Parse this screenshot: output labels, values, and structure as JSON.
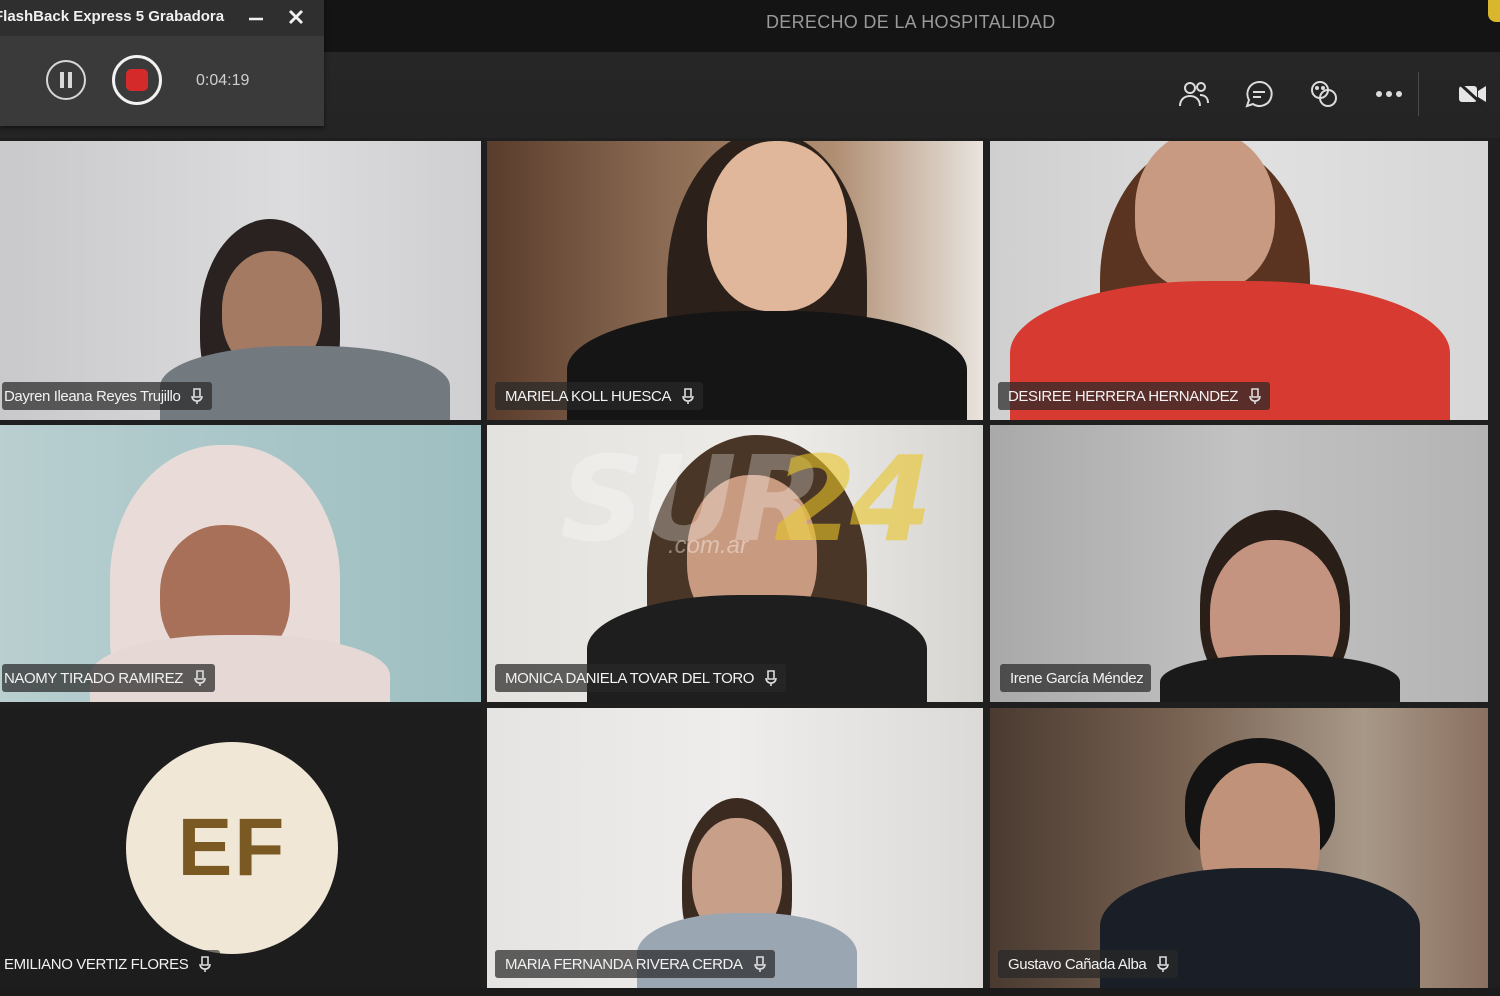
{
  "meeting": {
    "title": "DERECHO DE LA HOSPITALIDAD"
  },
  "recorder": {
    "title": "FlashBack Express 5 Grabadora",
    "elapsed": "0:04:19",
    "icons": [
      "pause-icon",
      "stop-record-icon",
      "minimize-icon",
      "close-icon"
    ]
  },
  "toolbar": {
    "icons": [
      "participants-icon",
      "chat-icon",
      "reactions-icon",
      "more-options-icon",
      "camera-off-icon"
    ]
  },
  "participants": [
    {
      "name": "Dayren Ileana Reyes Trujillo",
      "mic": "mic-icon"
    },
    {
      "name": "MARIELA KOLL HUESCA",
      "mic": "mic-icon"
    },
    {
      "name": "DESIREE HERRERA HERNANDEZ",
      "mic": "mic-icon"
    },
    {
      "name": "NAOMY TIRADO RAMIREZ",
      "mic": "mic-icon"
    },
    {
      "name": "MONICA DANIELA TOVAR DEL TORO",
      "mic": "mic-icon"
    },
    {
      "name": "Irene García Méndez",
      "mic": "",
      "selected": true
    },
    {
      "name": "EMILIANO VERTIZ FLORES",
      "mic": "mic-icon",
      "initials": "EF"
    },
    {
      "name": "MARIA FERNANDA RIVERA CERDA",
      "mic": "mic-icon"
    },
    {
      "name": "Gustavo Cañada Alba",
      "mic": "mic-icon"
    }
  ],
  "watermark": {
    "main": "SUR",
    "number": "24",
    "domain": ".com.ar"
  },
  "colors": {
    "accent": "#5b5fc7",
    "record_red": "#d42a2a",
    "avatar_bg": "#f1e7d6",
    "avatar_text": "#7a5a22"
  }
}
